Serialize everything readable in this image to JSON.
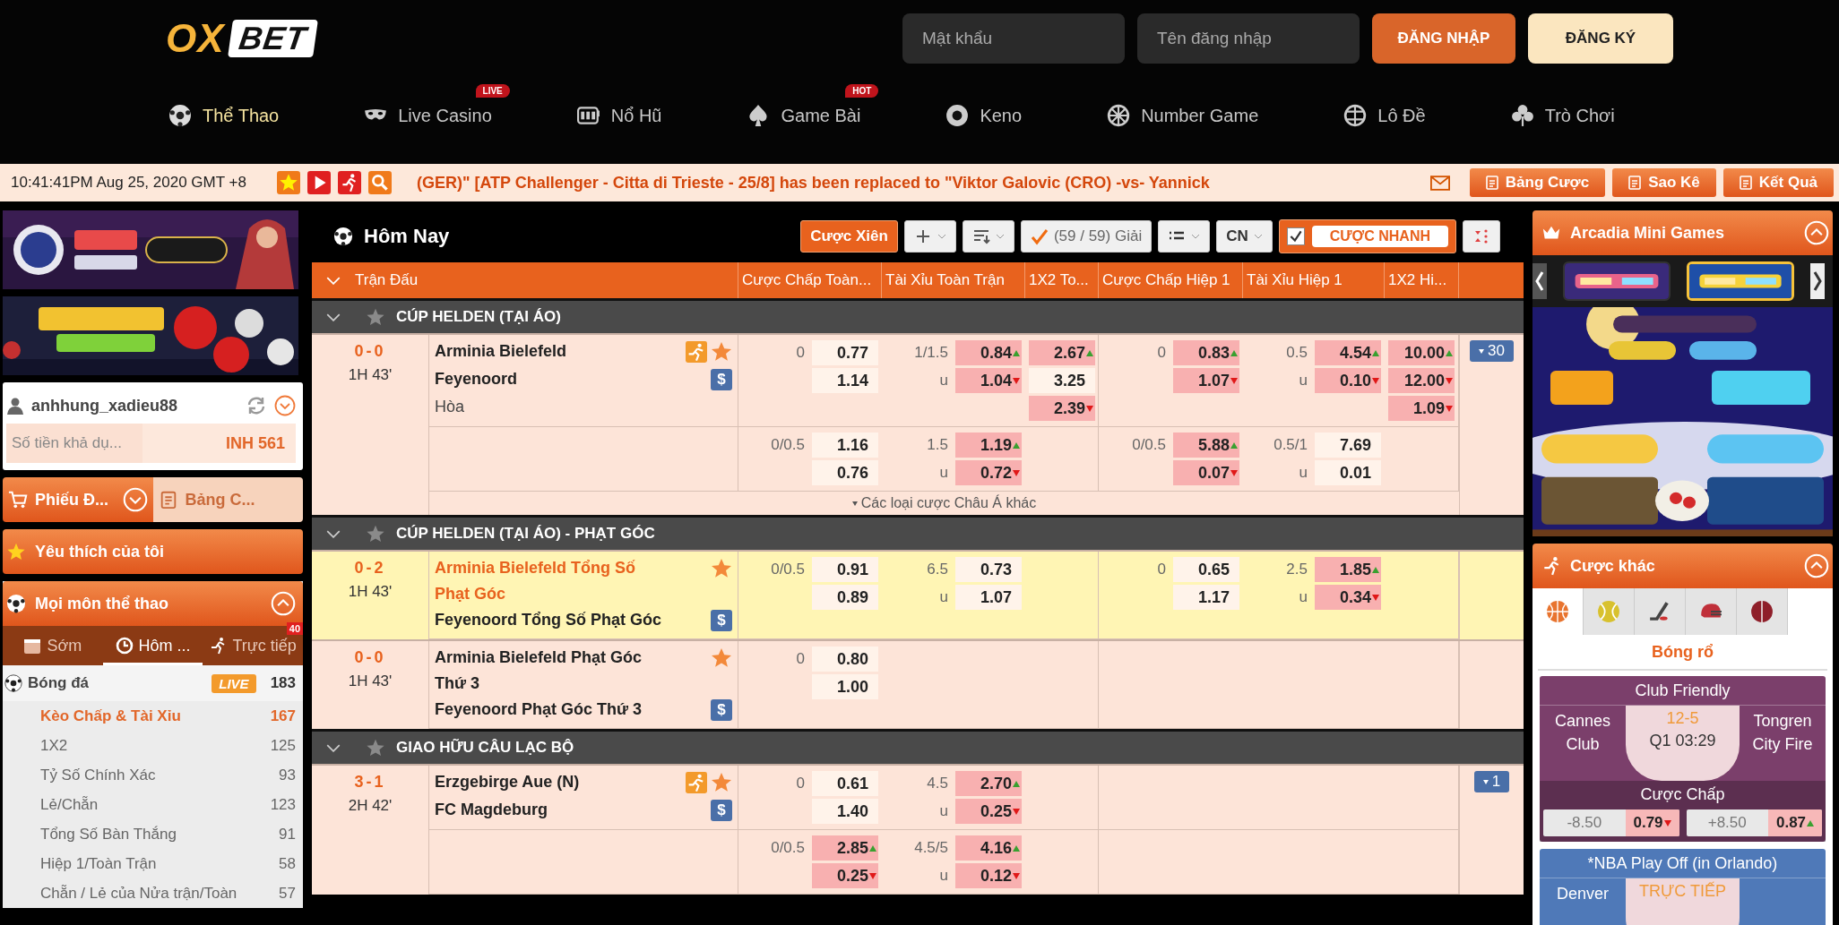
{
  "header": {
    "logo": {
      "part_1": "OX",
      "part_2": "BET"
    },
    "fields": [
      {
        "placeholder": "Mật khẩu"
      },
      {
        "placeholder": "Tên đăng nhập"
      }
    ],
    "buttons": [
      {
        "label": "ĐĂNG NHẬP",
        "kind": "primary"
      },
      {
        "label": "ĐĂNG KÝ",
        "kind": "secondary"
      }
    ],
    "nav": [
      {
        "label": "Thể Thao",
        "selected": true
      },
      {
        "label": "Live Casino",
        "badge": "LIVE",
        "selected": false
      },
      {
        "label": "Nổ Hũ",
        "selected": false
      },
      {
        "label": "Game Bài",
        "badge": "HOT",
        "selected": false
      },
      {
        "label": "Keno",
        "selected": false
      },
      {
        "label": "Number Game",
        "selected": false
      },
      {
        "label": "Lô Đề",
        "selected": false
      },
      {
        "label": "Trò Chơi",
        "selected": false
      }
    ]
  },
  "ticker": {
    "clock": "10:41:41PM Aug 25, 2020 GMT +8",
    "message": "(GER)\" [ATP Challenger - Citta di Trieste - 25/8] has been replaced to \"Viktor Galovic (CRO) -vs- Yannick",
    "buttons": [
      "Bảng Cược",
      "Sao Kê",
      "Kết Quả"
    ]
  },
  "left": {
    "user": "anhhung_xadieu88",
    "balance_label": "Số tiền khả dụ...",
    "balance": "INH 561",
    "tabs": [
      {
        "label": "Phiếu Đ...",
        "selected": true
      },
      {
        "label": "Bảng C...",
        "selected": false
      }
    ],
    "favorites": "Yêu thích của tôi",
    "sports_title": "Mọi môn thể thao",
    "time_tabs": [
      {
        "label": "Sớm",
        "selected": false
      },
      {
        "label": "Hôm ...",
        "selected": true
      },
      {
        "label": "Trực tiếp",
        "badge": "40",
        "selected": false
      }
    ],
    "sport": {
      "name": "Bóng đá",
      "badge": "LIVE",
      "count": "183"
    },
    "bet_types": [
      {
        "label": "Kèo Chấp & Tài Xỉu",
        "count": "167",
        "selected": true
      },
      {
        "label": "1X2",
        "count": "125",
        "selected": false
      },
      {
        "label": "Tỷ Số Chính Xác",
        "count": "93",
        "selected": false
      },
      {
        "label": "Lẻ/Chẵn",
        "count": "123",
        "selected": false
      },
      {
        "label": "Tổng Số Bàn Thắng",
        "count": "91",
        "selected": false
      },
      {
        "label": "Hiệp 1/Toàn Trận",
        "count": "58",
        "selected": false
      },
      {
        "label": "Chẵn / Lẻ của Nửa trận/Toàn",
        "count": "57",
        "selected": false
      }
    ]
  },
  "main": {
    "title": "Hôm Nay",
    "parlay": "Cược Xiên",
    "leagues_filter": "(59 / 59) Giải",
    "language": "CN",
    "quick_bet": {
      "label": "CƯỢC NHANH",
      "checked": true
    },
    "columns": [
      "Trận Đấu",
      "Cược Chấp Toàn...",
      "Tài Xỉu Toàn Trận",
      "1X2 To...",
      "Cược Chấp Hiệp 1",
      "Tài Xỉu Hiệp 1",
      "1X2 Hi..."
    ],
    "leagues": [
      {
        "name": "CÚP HELDEN (TẠI ÁO)",
        "matches": [
          {
            "score": "0-0",
            "time": "1H 43'",
            "highlighted": false,
            "home": "Arminia Bielefeld",
            "away": "Feyenoord",
            "draw": "Hòa",
            "live": true,
            "cash": "$",
            "more": "30",
            "footer": "Các loại cược Châu Á khác",
            "lines": [
              {
                "markets": {
                  "handicap_ft": [
                    {
                      "label": "0",
                      "odds": "0.77",
                      "hot": false
                    },
                    {
                      "odds": "1.14",
                      "hot": false
                    }
                  ],
                  "ou_ft": [
                    {
                      "label": "1/1.5",
                      "odds": "0.84",
                      "hot": true,
                      "rising": true
                    },
                    {
                      "label": "u",
                      "odds": "1.04",
                      "hot": true,
                      "rising": false
                    }
                  ],
                  "x12_ft": [
                    {
                      "odds": "2.67",
                      "hot": true,
                      "rising": true
                    },
                    {
                      "odds": "3.25",
                      "hot": false
                    },
                    {
                      "odds": "2.39",
                      "hot": true,
                      "rising": false
                    }
                  ],
                  "handicap_h1": [
                    {
                      "label": "0",
                      "odds": "0.83",
                      "hot": true,
                      "rising": true
                    },
                    {
                      "odds": "1.07",
                      "hot": true,
                      "rising": false
                    }
                  ],
                  "ou_h1": [
                    {
                      "label": "0.5",
                      "odds": "4.54",
                      "hot": true,
                      "rising": true
                    },
                    {
                      "label": "u",
                      "odds": "0.10",
                      "hot": true,
                      "rising": false
                    }
                  ],
                  "x12_h1": [
                    {
                      "odds": "10.00",
                      "hot": true,
                      "rising": true
                    },
                    {
                      "odds": "12.00",
                      "hot": true,
                      "rising": false
                    },
                    {
                      "odds": "1.09",
                      "hot": true,
                      "rising": false
                    }
                  ]
                }
              },
              {
                "markets": {
                  "handicap_ft": [
                    {
                      "label": "0/0.5",
                      "odds": "1.16",
                      "hot": false
                    },
                    {
                      "odds": "0.76",
                      "hot": false
                    }
                  ],
                  "ou_ft": [
                    {
                      "label": "1.5",
                      "odds": "1.19",
                      "hot": true,
                      "rising": true
                    },
                    {
                      "label": "u",
                      "odds": "0.72",
                      "hot": true,
                      "rising": false
                    }
                  ],
                  "handicap_h1": [
                    {
                      "label": "0/0.5",
                      "odds": "5.88",
                      "hot": true,
                      "rising": true
                    },
                    {
                      "odds": "0.07",
                      "hot": true,
                      "rising": false
                    }
                  ],
                  "ou_h1": [
                    {
                      "label": "0.5/1",
                      "odds": "7.69",
                      "hot": false
                    },
                    {
                      "label": "u",
                      "odds": "0.01",
                      "hot": false
                    }
                  ]
                }
              }
            ]
          }
        ]
      },
      {
        "name": "CÚP HELDEN (TẠI ÁO) - PHẠT GÓC",
        "matches": [
          {
            "score": "0-2",
            "time": "1H 43'",
            "highlighted": true,
            "home": "Arminia Bielefeld Tổng Số Phạt Góc",
            "away": "Feyenoord Tổng Số Phạt Góc",
            "live": false,
            "cash": "$",
            "lines": [
              {
                "markets": {
                  "handicap_ft": [
                    {
                      "label": "0/0.5",
                      "odds": "0.91",
                      "hot": false
                    },
                    {
                      "odds": "0.89",
                      "hot": false
                    }
                  ],
                  "ou_ft": [
                    {
                      "label": "6.5",
                      "odds": "0.73",
                      "hot": false
                    },
                    {
                      "label": "u",
                      "odds": "1.07",
                      "hot": false
                    }
                  ],
                  "handicap_h1": [
                    {
                      "label": "0",
                      "odds": "0.65",
                      "hot": false
                    },
                    {
                      "odds": "1.17",
                      "hot": false
                    }
                  ],
                  "ou_h1": [
                    {
                      "label": "2.5",
                      "odds": "1.85",
                      "hot": true,
                      "rising": true
                    },
                    {
                      "label": "u",
                      "odds": "0.34",
                      "hot": true,
                      "rising": false
                    }
                  ]
                }
              }
            ]
          },
          {
            "score": "0-0",
            "time": "1H 43'",
            "highlighted": false,
            "home": "Arminia Bielefeld Phạt Góc Thứ 3",
            "away": "Feyenoord Phạt Góc Thứ 3",
            "live": false,
            "cash": "$",
            "lines": [
              {
                "markets": {
                  "handicap_ft": [
                    {
                      "label": "0",
                      "odds": "0.80",
                      "hot": false
                    },
                    {
                      "odds": "1.00",
                      "hot": false
                    }
                  ]
                }
              }
            ]
          }
        ]
      },
      {
        "name": "GIAO HỮU CÂU LẠC BỘ",
        "matches": [
          {
            "score": "3-1",
            "time": "2H 42'",
            "highlighted": false,
            "home": "Erzgebirge Aue (N)",
            "away": "FC Magdeburg",
            "live": true,
            "cash": "$",
            "more": "1",
            "lines": [
              {
                "markets": {
                  "handicap_ft": [
                    {
                      "label": "0",
                      "odds": "0.61",
                      "hot": false
                    },
                    {
                      "odds": "1.40",
                      "hot": false
                    }
                  ],
                  "ou_ft": [
                    {
                      "label": "4.5",
                      "odds": "2.70",
                      "hot": true,
                      "rising": true
                    },
                    {
                      "label": "u",
                      "odds": "0.25",
                      "hot": true,
                      "rising": false
                    }
                  ]
                }
              },
              {
                "markets": {
                  "handicap_ft": [
                    {
                      "label": "0/0.5",
                      "odds": "2.85",
                      "hot": true,
                      "rising": true
                    },
                    {
                      "odds": "0.25",
                      "hot": true,
                      "rising": false
                    }
                  ],
                  "ou_ft": [
                    {
                      "label": "4.5/5",
                      "odds": "4.16",
                      "hot": true,
                      "rising": true
                    },
                    {
                      "label": "u",
                      "odds": "0.12",
                      "hot": true,
                      "rising": false
                    }
                  ]
                }
              }
            ]
          }
        ]
      }
    ]
  },
  "right": {
    "mini_games": {
      "title": "Arcadia Mini Games",
      "games": [
        {
          "kind": "picture",
          "selected": false
        },
        {
          "kind": "picture",
          "selected": true
        }
      ]
    },
    "other_bets": {
      "title": "Cược khác",
      "sports": [
        {
          "selected": true
        },
        {
          "selected": false
        },
        {
          "selected": false
        },
        {
          "selected": false
        },
        {
          "selected": false
        }
      ],
      "sport_name": "Bóng rổ",
      "cards": [
        {
          "color": "#7b3f6b",
          "league": "Club Friendly",
          "home": "Cannes Club",
          "away": "Tongren City Fire",
          "score": "12-5",
          "clock": "Q1 03:29",
          "market": "Cược Chấp",
          "odds": [
            {
              "line": "-8.50",
              "odds": "0.79",
              "rising": false
            },
            {
              "line": "+8.50",
              "odds": "0.87",
              "rising": true
            }
          ]
        },
        {
          "color": "#4f79b8",
          "league": "*NBA Play Off (in Orlando)",
          "home": "Denver",
          "status": "TRỰC TIẾP"
        }
      ]
    }
  }
}
